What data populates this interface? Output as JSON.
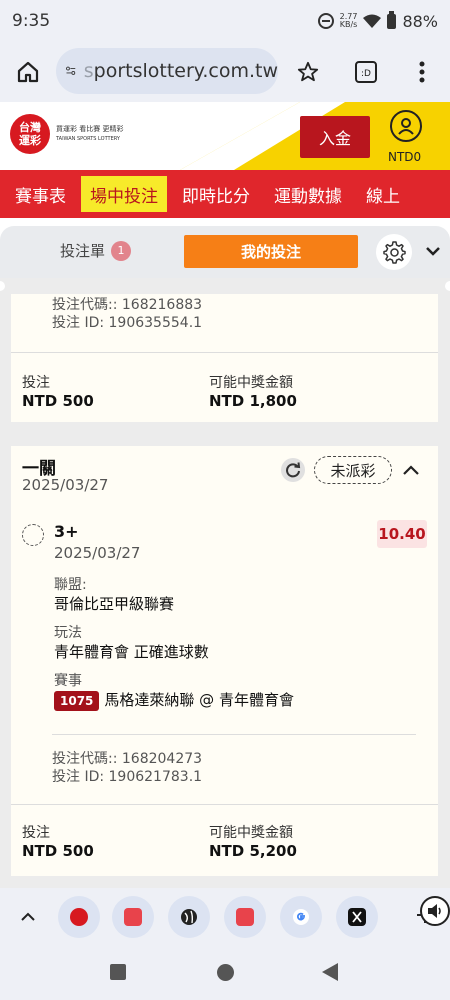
{
  "status_bar": {
    "time": "9:35",
    "speed_value": "2.77",
    "speed_unit": "KB/s",
    "battery": "88%"
  },
  "browser": {
    "url": "sportslottery.com.tw",
    "url_faded_prefix": "s"
  },
  "site": {
    "logo_line1": "台灣",
    "logo_line2": "運彩",
    "slogan": "買運彩 看比賽 更精彩",
    "brand_en": "TAIWAN SPORTS LOTTERY",
    "deposit_label": "入金",
    "balance": "NTD0"
  },
  "nav": {
    "items": [
      "賽事表",
      "場中投注",
      "即時比分",
      "運動數據",
      "線上"
    ],
    "active_index": 1
  },
  "bet_tabs": {
    "slip_label": "投注單",
    "slip_count": "1",
    "mybets_label": "我的投注"
  },
  "card1": {
    "code_line": "投注代碼:: 168216883",
    "id_line": "投注 ID: 190635554.1",
    "stake_label": "投注",
    "stake_value": "NTD 500",
    "payout_label": "可能中獎金額",
    "payout_value": "NTD 1,800"
  },
  "card2": {
    "title": "一關",
    "date": "2025/03/27",
    "status": "未派彩",
    "selection": "3+",
    "selection_date": "2025/03/27",
    "odds": "10.40",
    "league_label": "聯盟:",
    "league_value": "哥倫比亞甲級聯賽",
    "market_label": "玩法",
    "market_value": "青年體育會 正確進球數",
    "event_label": "賽事",
    "event_number": "1075",
    "event_value": "馬格達萊納聯 @ 青年體育會",
    "code_line": "投注代碼:: 168204273",
    "id_line": "投注 ID: 190621783.1",
    "stake_label": "投注",
    "stake_value": "NTD 500",
    "payout_label": "可能中獎金額",
    "payout_value": "NTD 5,200"
  },
  "colors": {
    "brand_red": "#e0262c",
    "brand_yellow": "#f7d200",
    "orange": "#f67f16",
    "dark_red": "#a3111a"
  }
}
